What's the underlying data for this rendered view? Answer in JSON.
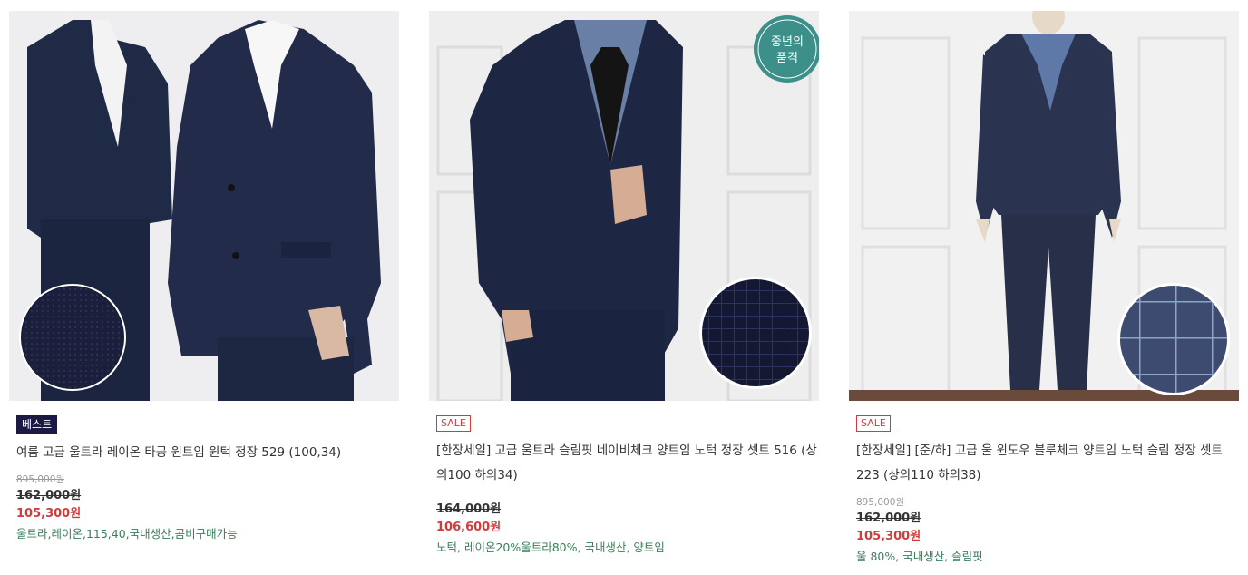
{
  "products": [
    {
      "badge": "베스트",
      "title": "여름 고급 울트라 레이온 타공 원트임 원턱 정장 529 (100,34)",
      "list_price": "895,000원",
      "consumer_price": "162,000원",
      "sale_price": "105,300원",
      "tags": "울트라,레이온,115,40,국내생산,콤비구매가능"
    },
    {
      "badge": "SALE",
      "title": "[한장세일] 고급 울트라 슬림핏 네이비체크 양트임 노턱 정장 셋트 516 (상의100 하의34)",
      "list_price": "",
      "consumer_price": "164,000원",
      "sale_price": "106,600원",
      "tags": "노턱, 레이온20%울트라80%, 국내생산, 양트임",
      "logo_text": "중년의 품격"
    },
    {
      "badge": "SALE",
      "title": "[한장세일] [준/하] 고급 울 윈도우 블루체크 양트임 노턱 슬림 정장 셋트 223 (상의110 하의38)",
      "list_price": "895,000원",
      "consumer_price": "162,000원",
      "sale_price": "105,300원",
      "tags": "울 80%, 국내생산, 슬림핏"
    }
  ],
  "colors": {
    "navy_suit": "#1e2845",
    "badge_best_bg": "#1b1a45",
    "sale_red": "#d33b3b",
    "tag_green": "#3a7d5a"
  }
}
